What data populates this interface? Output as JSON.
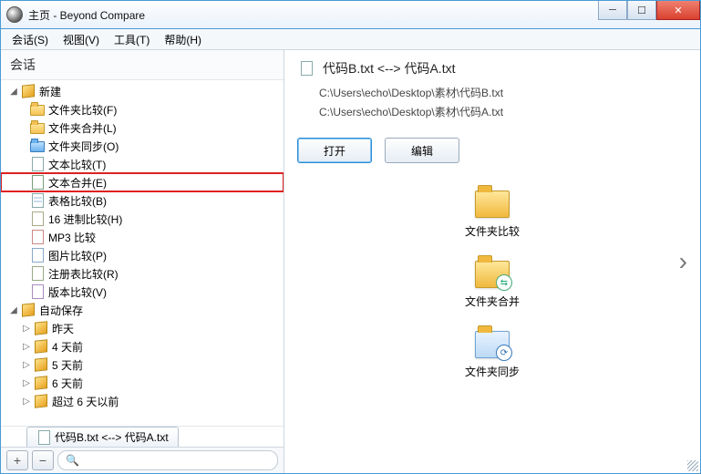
{
  "title": "主页 - Beyond Compare",
  "menu": {
    "session": "会话(S)",
    "view": "视图(V)",
    "tools": "工具(T)",
    "help": "帮助(H)"
  },
  "side_head": "会话",
  "tree": {
    "new_group": "新建",
    "items": [
      "文件夹比较(F)",
      "文件夹合并(L)",
      "文件夹同步(O)",
      "文本比较(T)",
      "文本合并(E)",
      "表格比较(B)",
      "16 进制比较(H)",
      "MP3 比较",
      "图片比较(P)",
      "注册表比较(R)",
      "版本比较(V)"
    ],
    "autosave_group": "自动保存",
    "autosave": [
      "昨天",
      "4 天前",
      "5 天前",
      "6 天前",
      "超过 6 天以前"
    ]
  },
  "tab_label": "代码B.txt <--> 代码A.txt",
  "bottom": {
    "plus": "+",
    "minus": "−",
    "search_ph": "🔍"
  },
  "main": {
    "title": "代码B.txt <--> 代码A.txt",
    "path1": "C:\\Users\\echo\\Desktop\\素材\\代码B.txt",
    "path2": "C:\\Users\\echo\\Desktop\\素材\\代码A.txt",
    "open": "打开",
    "edit": "编辑",
    "g1": "文件夹比较",
    "g2": "文件夹合并",
    "g3": "文件夹同步"
  }
}
